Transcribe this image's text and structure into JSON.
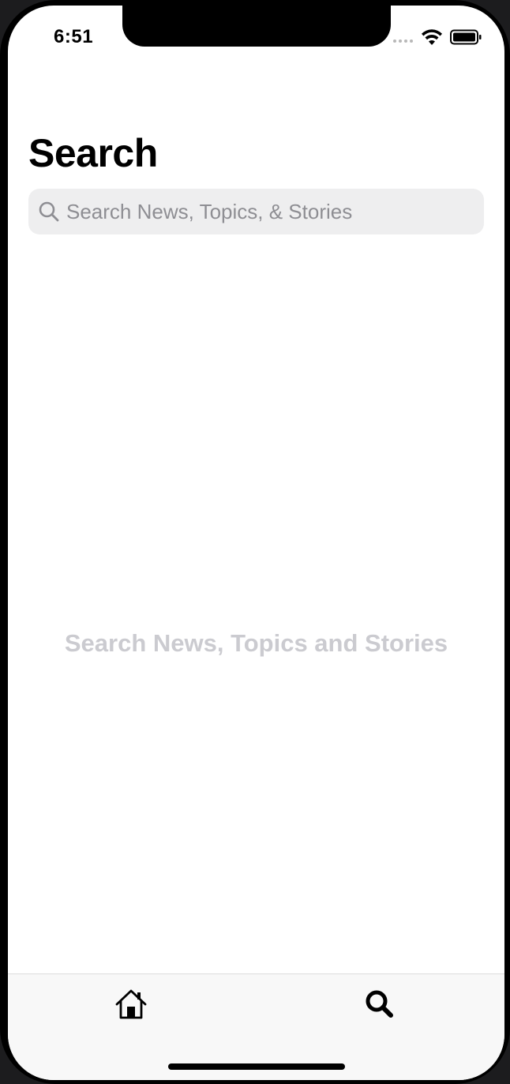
{
  "status_bar": {
    "time": "6:51"
  },
  "header": {
    "title": "Search"
  },
  "search": {
    "placeholder": "Search News, Topics, & Stories",
    "value": "",
    "icon": "magnifying-glass"
  },
  "main": {
    "empty_message": "Search News, Topics and Stories"
  },
  "tab_bar": {
    "tabs": [
      {
        "icon": "house",
        "selected": false
      },
      {
        "icon": "magnifying-glass",
        "selected": true
      }
    ]
  },
  "colors": {
    "background": "#ffffff",
    "search_field": "#eeeeef",
    "placeholder": "#8e8e93",
    "empty_message": "#cbcbd0",
    "tab_bar": "#f8f8f8"
  }
}
